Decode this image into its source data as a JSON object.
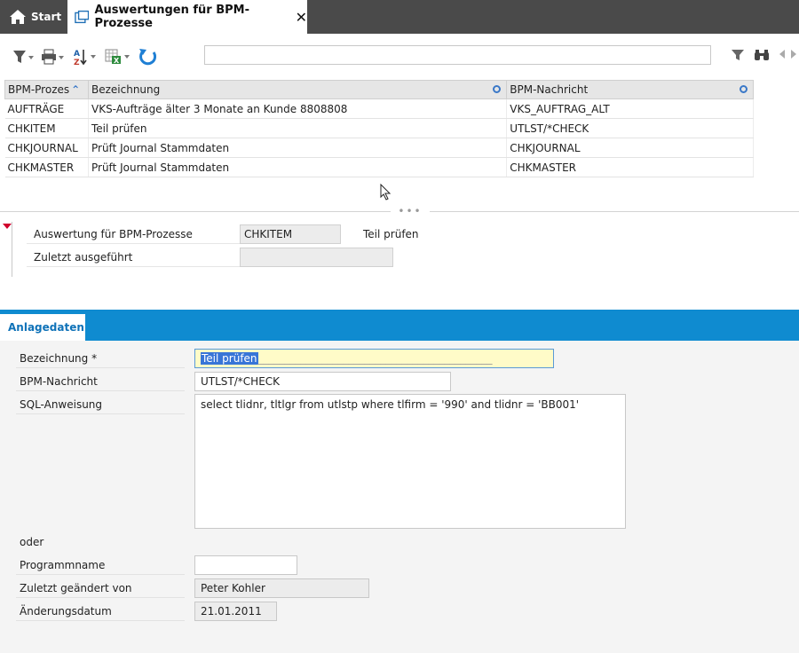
{
  "tabs": {
    "start": "Start",
    "active": "Auswertungen für BPM-Prozesse",
    "close": "✕"
  },
  "grid": {
    "headers": [
      "BPM-Prozes",
      "Bezeichnung",
      "BPM-Nachricht"
    ],
    "rows": [
      [
        "AUFTRÄGE",
        "VKS-Aufträge älter 3 Monate an Kunde 8808808",
        "VKS_AUFTRAG_ALT"
      ],
      [
        "CHKITEM",
        "Teil prüfen",
        "UTLST/*CHECK"
      ],
      [
        "CHKJOURNAL",
        "Prüft Journal Stammdaten",
        "CHKJOURNAL"
      ],
      [
        "CHKMASTER",
        "Prüft Journal Stammdaten",
        "CHKMASTER"
      ]
    ]
  },
  "splitter": "•••",
  "detail": {
    "label1": "Auswertung für BPM-Prozesse",
    "value1": "CHKITEM",
    "text1": "Teil prüfen",
    "label2": "Zuletzt ausgeführt",
    "value2": ""
  },
  "subtab": "Anlagedaten",
  "form": {
    "bezeichnung_label": "Bezeichnung *",
    "bezeichnung_value": "Teil prüfen",
    "bezeichnung_fill": "____________________________________________",
    "nachricht_label": "BPM-Nachricht",
    "nachricht_value": "UTLST/*CHECK",
    "sql_label": "SQL-Anweisung",
    "sql_value": "select tlidnr, tltlgr from utlstp where tlfirm = '990' and tlidnr = 'BB001'",
    "oder": "oder",
    "programm_label": "Programmname",
    "programm_value": "",
    "geaendert_label": "Zuletzt geändert von",
    "geaendert_value": "Peter Kohler",
    "datum_label": "Änderungsdatum",
    "datum_value": "21.01.2011"
  },
  "colors": {
    "tabbar": "#4a4a4a",
    "accent": "#0f8bd0",
    "marker": "#d0002c"
  }
}
